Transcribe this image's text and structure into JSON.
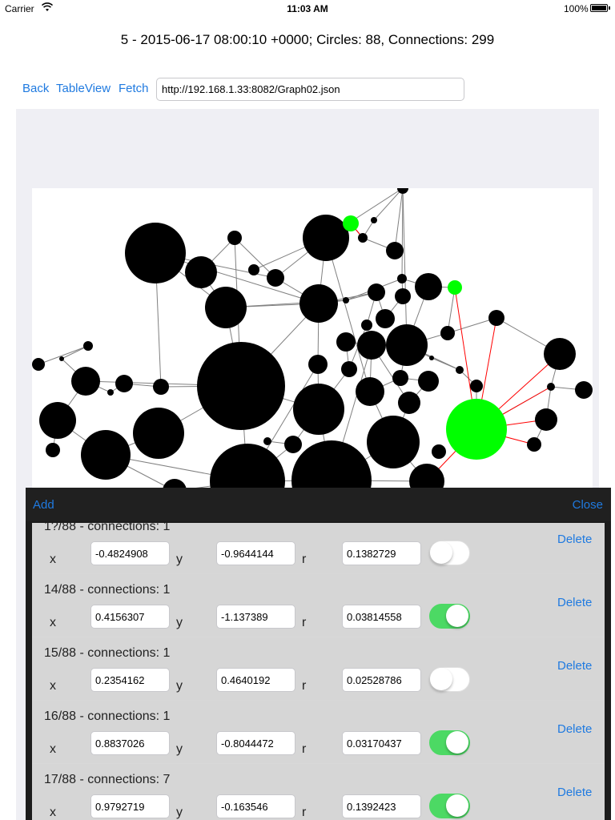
{
  "status_bar": {
    "carrier": "Carrier",
    "time": "11:03 AM",
    "battery": "100%"
  },
  "info_title": "5 - 2015-06-17 08:00:10 +0000; Circles: 88, Connections: 299",
  "toolbar": {
    "back": "Back",
    "tableview": "TableView",
    "fetch": "Fetch",
    "url": "http://192.168.1.33:8082/Graph02.json"
  },
  "colors": {
    "link": "#1f7ae0",
    "highlight_node": "#00ff00",
    "highlight_edge": "#ff0000",
    "toggle_on": "#4cd964",
    "node": "#000000",
    "edge": "#808080"
  },
  "panel": {
    "add": "Add",
    "close": "Close"
  },
  "rows": [
    {
      "title": "1?/88 - connections: 1",
      "x": "-0.4824908",
      "y": "-0.9644144",
      "r": "0.1382729",
      "enabled": false,
      "delete": "Delete"
    },
    {
      "title": "14/88 - connections: 1",
      "x": "0.4156307",
      "y": "-1.137389",
      "r": "0.03814558",
      "enabled": true,
      "delete": "Delete"
    },
    {
      "title": "15/88 - connections: 1",
      "x": "0.2354162",
      "y": "0.4640192",
      "r": "0.02528786",
      "enabled": false,
      "delete": "Delete"
    },
    {
      "title": "16/88 - connections: 1",
      "x": "0.8837026",
      "y": "-0.8044472",
      "r": "0.03170437",
      "enabled": true,
      "delete": "Delete"
    },
    {
      "title": "17/88 - connections: 7",
      "x": "0.9792719",
      "y": "-0.163546",
      "r": "0.1392423",
      "enabled": true,
      "delete": "Delete"
    }
  ],
  "field_labels": {
    "x": "x",
    "y": "y",
    "r": "r"
  }
}
